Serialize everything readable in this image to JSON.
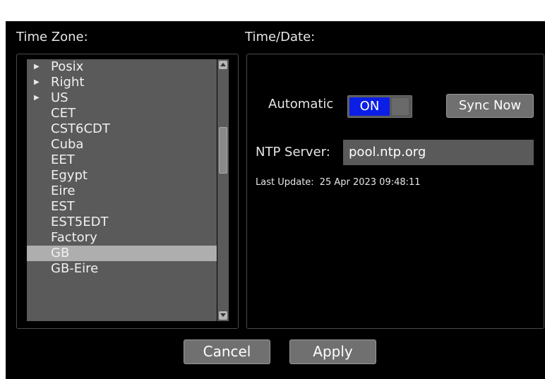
{
  "time_zone": {
    "label": "Time Zone:",
    "items": [
      {
        "label": "Posix",
        "expandable": true
      },
      {
        "label": "Right",
        "expandable": true
      },
      {
        "label": "US",
        "expandable": true
      },
      {
        "label": "CET"
      },
      {
        "label": "CST6CDT"
      },
      {
        "label": "Cuba"
      },
      {
        "label": "EET"
      },
      {
        "label": "Egypt"
      },
      {
        "label": "Eire"
      },
      {
        "label": "EST"
      },
      {
        "label": "EST5EDT"
      },
      {
        "label": "Factory"
      },
      {
        "label": "GB",
        "selected": true
      },
      {
        "label": "GB-Eire"
      }
    ]
  },
  "time_date": {
    "label": "Time/Date:",
    "automatic_label": "Automatic",
    "automatic_state": "ON",
    "sync_label": "Sync Now",
    "ntp_label": "NTP Server:",
    "ntp_value": "pool.ntp.org",
    "last_update_label": "Last Update:",
    "last_update_value": "25 Apr 2023 09:48:11"
  },
  "footer": {
    "cancel_label": "Cancel",
    "apply_label": "Apply"
  },
  "colors": {
    "toggle_on": "#0a1ee6",
    "selected_row": "#aeaeae",
    "list_bg": "#5a5a5a"
  }
}
